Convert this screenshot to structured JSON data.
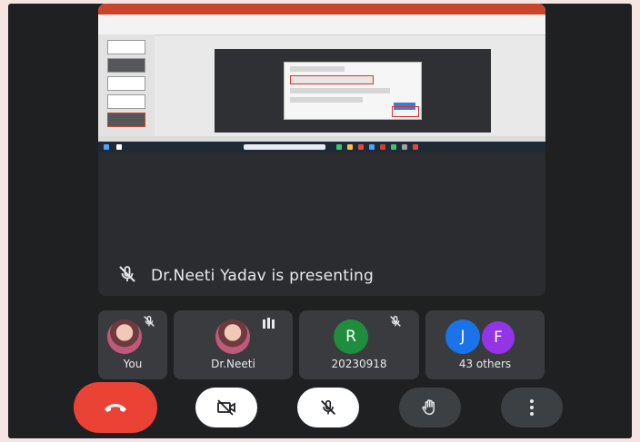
{
  "presenting": {
    "text": "Dr.Neeti Yadav is presenting"
  },
  "participants": [
    {
      "name": "You",
      "avatar": "photo",
      "muted": true
    },
    {
      "name": "Dr.Neeti",
      "avatar": "photo",
      "speaking": true
    },
    {
      "name": "20230918",
      "avatar_letter": "R",
      "avatar_color": "#1e8e3e",
      "muted": true
    },
    {
      "name": "43 others",
      "avatar_letters": [
        "J",
        "F"
      ],
      "avatar_colors": [
        "#1a73e8",
        "#9334e6"
      ]
    }
  ],
  "controls": [
    {
      "icon": "end-call-icon",
      "color": "#ea4335"
    },
    {
      "icon": "camera-off-icon",
      "color": "#ffffff"
    },
    {
      "icon": "mic-off-icon",
      "color": "#ffffff"
    },
    {
      "icon": "raise-hand-icon",
      "color": "#3c4043"
    },
    {
      "icon": "more-vert-icon",
      "color": "#3c4043"
    }
  ]
}
